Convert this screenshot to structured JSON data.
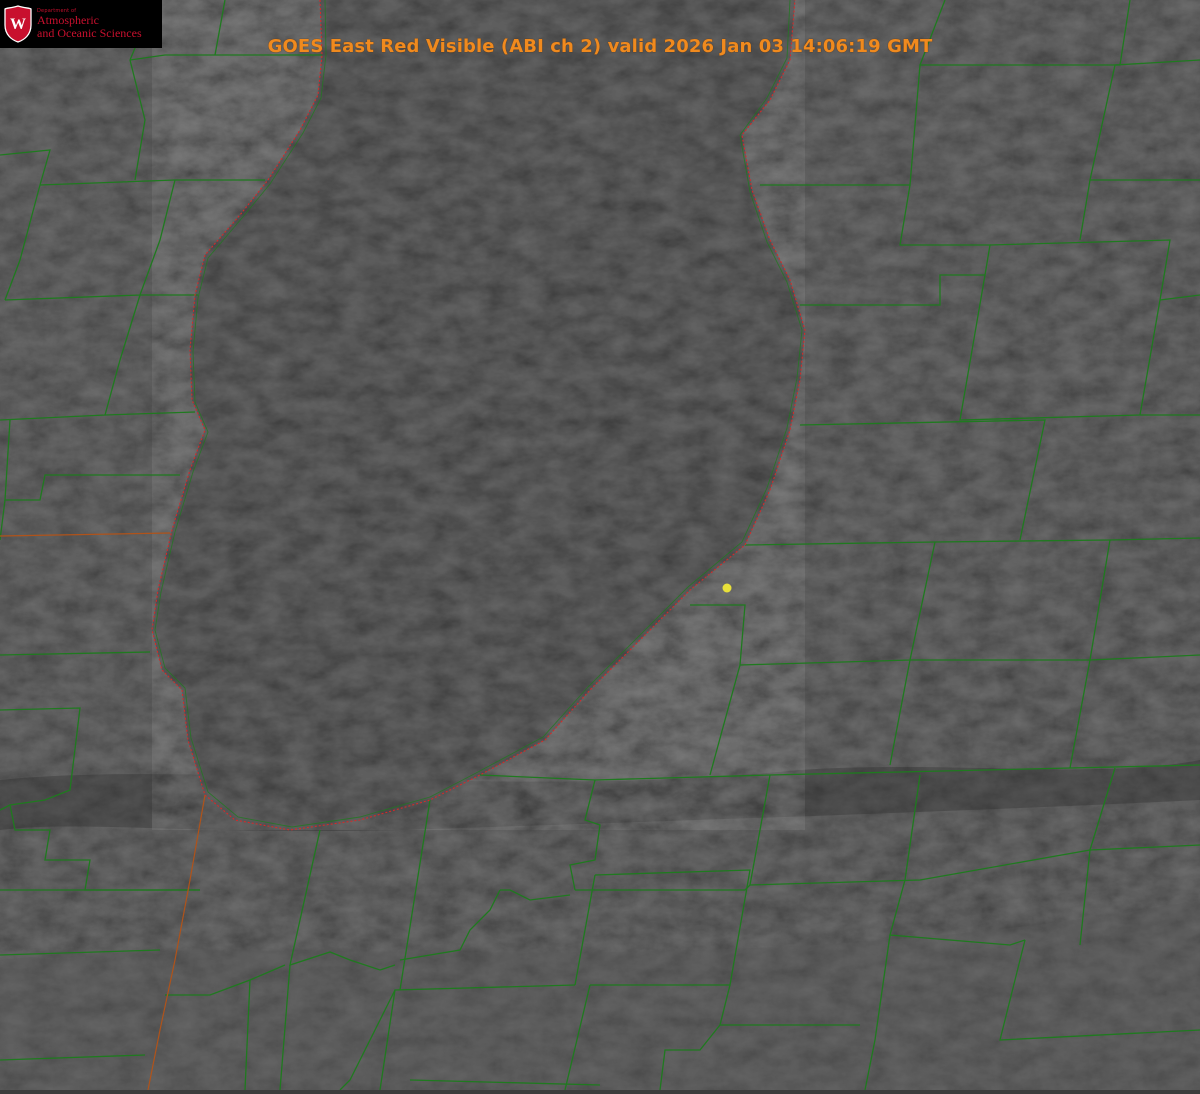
{
  "logo": {
    "small_text": "Department of",
    "line1": "Atmospheric",
    "line2": "and Oceanic Sciences",
    "shield_letter": "W",
    "shield_color": "#c8102e"
  },
  "title": "GOES East Red Visible (ABI ch 2) valid 2026 Jan 03 14:06:19 GMT",
  "colors": {
    "background": "#3c3c3c",
    "lake": "#3a3a3a",
    "county_lines": "#1f7a1f",
    "state_lines": "#b0531a",
    "shoreline": "#d42a2a",
    "marker": "#e8e03a",
    "title": "#f08a1e"
  }
}
